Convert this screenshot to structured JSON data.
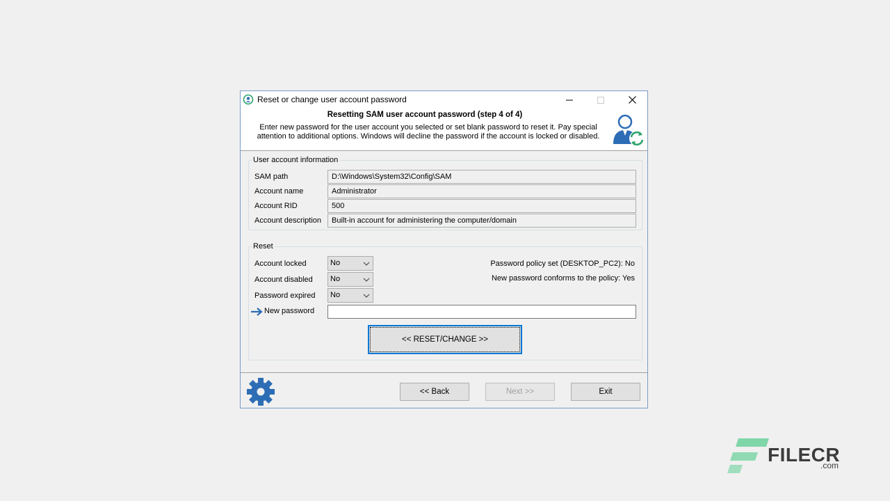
{
  "window": {
    "title": "Reset or change user account password",
    "header_title": "Resetting SAM user account password (step 4 of 4)",
    "header_description": "Enter new password for the user account you selected or set blank password to reset it. Pay special attention to additional options. Windows will decline the password if the account is locked or disabled."
  },
  "account_info": {
    "legend": "User account information",
    "rows": [
      {
        "label": "SAM path",
        "value": "D:\\Windows\\System32\\Config\\SAM"
      },
      {
        "label": "Account name",
        "value": "Administrator"
      },
      {
        "label": "Account RID",
        "value": "500"
      },
      {
        "label": "Account description",
        "value": "Built-in account for administering the computer/domain"
      }
    ]
  },
  "reset": {
    "legend": "Reset",
    "account_locked": {
      "label": "Account locked",
      "value": "No"
    },
    "account_disabled": {
      "label": "Account disabled",
      "value": "No"
    },
    "password_expired": {
      "label": "Password expired",
      "value": "No"
    },
    "new_password": {
      "label": "New password",
      "value": ""
    },
    "policy_set": "Password policy set (DESKTOP_PC2): No",
    "policy_conforms": "New password conforms to the policy: Yes",
    "reset_button": "<<  RESET/CHANGE  >>"
  },
  "footer": {
    "back": "<< Back",
    "next": "Next >>",
    "exit": "Exit"
  },
  "watermark": {
    "brand": "FILECR",
    "suffix": ".com"
  },
  "colors": {
    "accent": "#0078d7",
    "icon_blue": "#2d6db5",
    "icon_green": "#2ca36b",
    "watermark_green": "#7fd6a8"
  },
  "icons": [
    "app-icon",
    "minimize-icon",
    "maximize-icon",
    "close-icon",
    "user-refresh-icon",
    "arrow-right-icon",
    "chevron-down-icon",
    "gear-icon"
  ]
}
